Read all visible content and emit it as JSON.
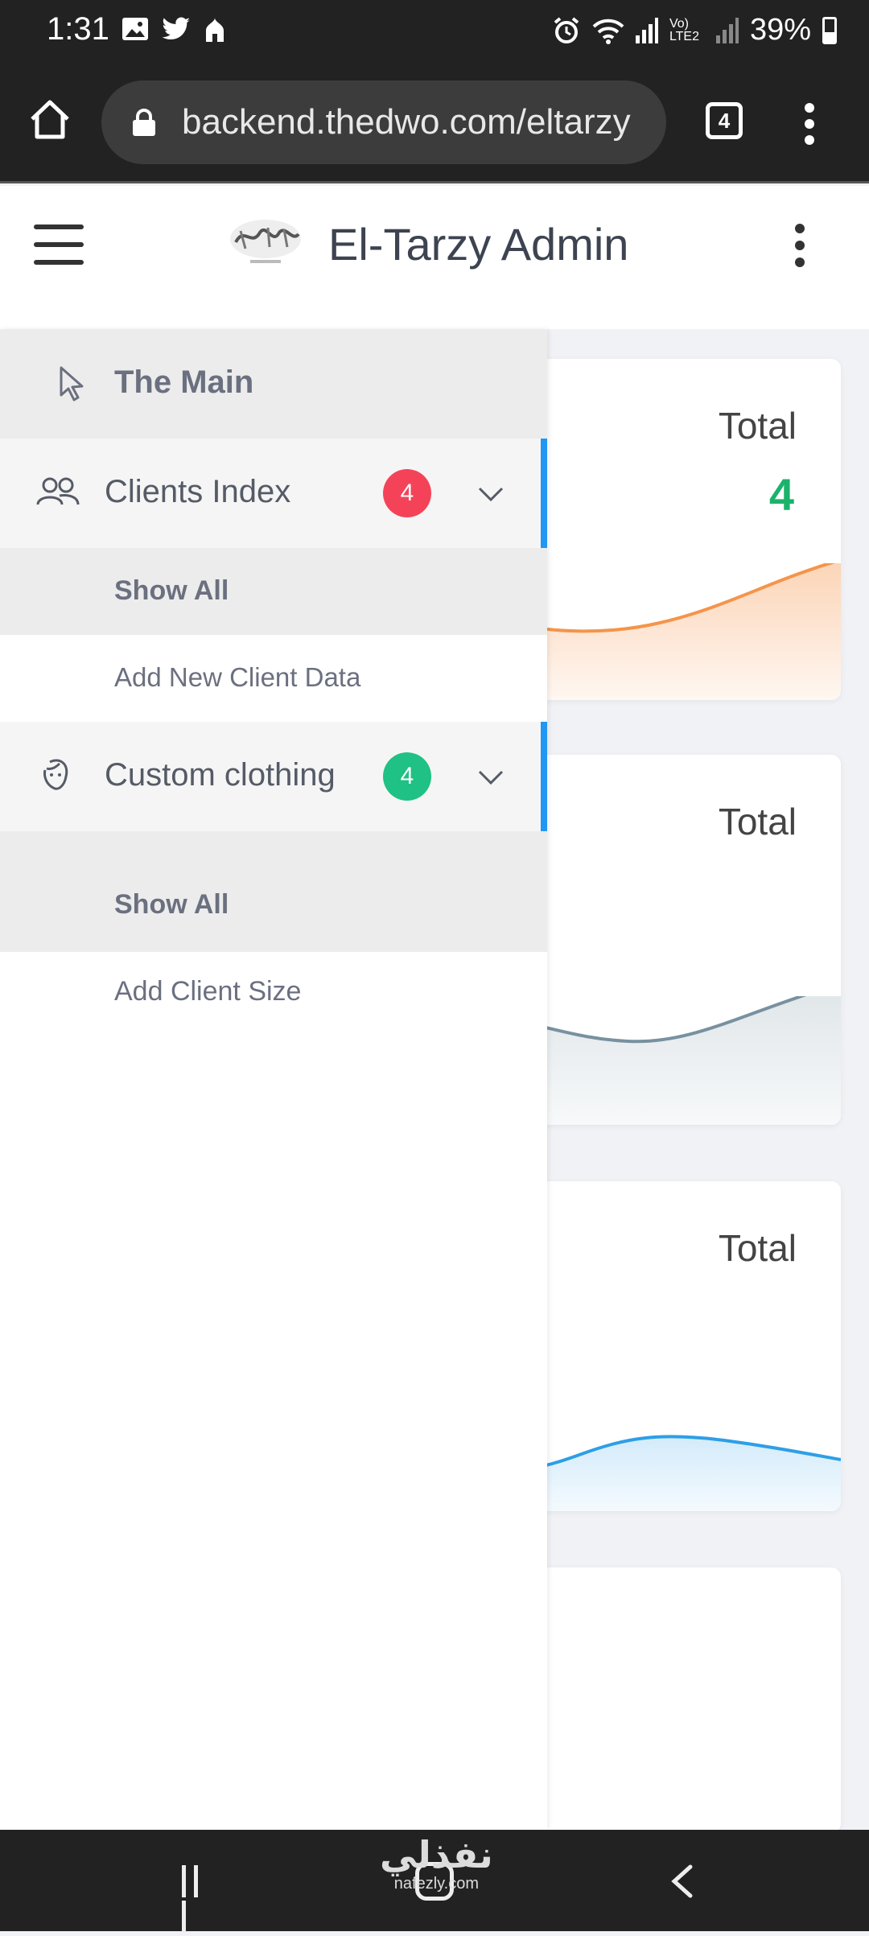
{
  "status_bar": {
    "time": "1:31",
    "signal_label": "Vo) LTE2",
    "battery": "39%",
    "left_icons": [
      "gallery-icon",
      "twitter-icon",
      "mosque-icon"
    ],
    "right_icons": [
      "alarm-icon",
      "wifi-icon",
      "signal-icon",
      "signal-icon",
      "battery-icon"
    ]
  },
  "browser": {
    "url": "backend.thedwo.com/eltarzy",
    "tab_count": "4"
  },
  "header": {
    "title": "El-Tarzy Admin"
  },
  "sidebar": {
    "main_label": "The Main",
    "groups": [
      {
        "label": "Clients Index",
        "icon": "users-icon",
        "badge": "4",
        "badge_color": "#f44358",
        "items": [
          "Show All",
          "Add New Client Data"
        ]
      },
      {
        "label": "Custom clothing",
        "icon": "face-icon",
        "badge": "4",
        "badge_color": "#1fc184",
        "items": [
          "Show All",
          "Add Client Size"
        ]
      }
    ]
  },
  "cards": [
    {
      "label": "Total",
      "value": "4",
      "line_color": "#f5944a"
    },
    {
      "label": "Total",
      "value": "",
      "line_color": "#7891a0"
    },
    {
      "label": "Total",
      "value": "",
      "line_color": "#2d9fe6"
    }
  ],
  "watermark": {
    "arabic": "نفذلي",
    "latin": "nafezly.com"
  },
  "colors": {
    "accent": "#2196f3",
    "success": "#1bb36b"
  }
}
